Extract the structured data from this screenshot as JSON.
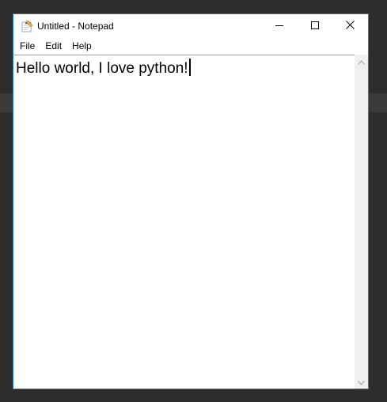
{
  "window": {
    "title": "Untitled - Notepad"
  },
  "menu": {
    "items": [
      {
        "label": "File"
      },
      {
        "label": "Edit"
      },
      {
        "label": "Help"
      }
    ]
  },
  "editor": {
    "content": "Hello world, I love python!"
  },
  "icons": {
    "app": "notepad-icon",
    "minimize": "minimize-icon",
    "maximize": "maximize-icon",
    "close": "close-icon",
    "scroll_up": "chevron-up-icon",
    "scroll_down": "chevron-down-icon"
  },
  "colors": {
    "window_border": "#1a7fd0",
    "desktop": "#2d2d2d",
    "scrollbar_track": "#f0f0f0"
  }
}
